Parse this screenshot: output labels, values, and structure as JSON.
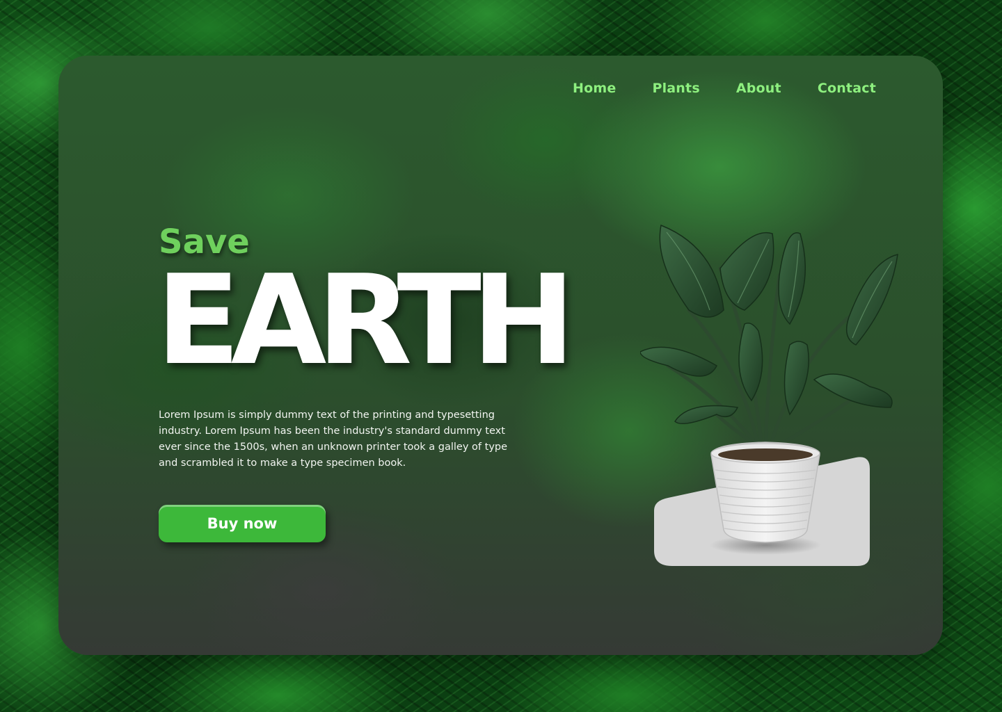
{
  "nav": {
    "items": [
      {
        "label": "Home"
      },
      {
        "label": "Plants"
      },
      {
        "label": "About"
      },
      {
        "label": "Contact"
      }
    ]
  },
  "hero": {
    "kicker": "Save",
    "title": "EARTH",
    "description": "Lorem Ipsum is simply dummy text of the printing and typesetting industry. Lorem Ipsum has been the industry's standard dummy text ever since the 1500s, when an unknown printer took a galley of type and scrambled it to make a type specimen book.",
    "cta_label": "Buy now"
  },
  "colors": {
    "accent": "#3db83a",
    "nav_text": "#8ef07f",
    "kicker_text": "#6fd05d"
  },
  "icons": {
    "plant": "potted-plant-icon"
  }
}
